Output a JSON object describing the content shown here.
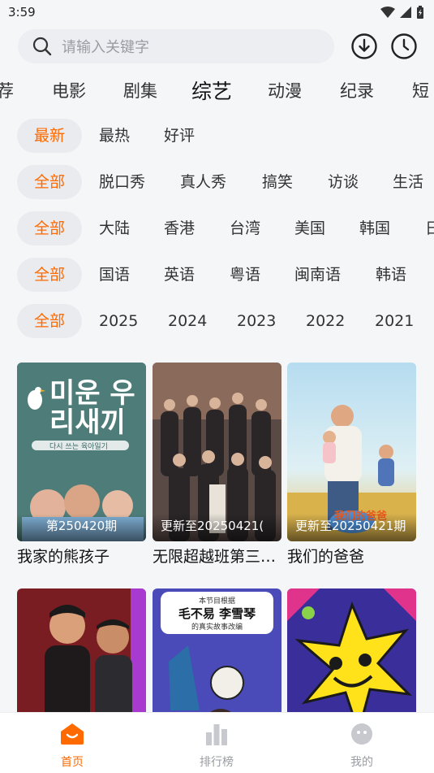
{
  "status_bar": {
    "time": "3:59"
  },
  "search": {
    "placeholder": "请输入关键字"
  },
  "category_tabs": [
    "荐",
    "电影",
    "剧集",
    "综艺",
    "动漫",
    "纪录",
    "短"
  ],
  "filters": {
    "sort": [
      "最新",
      "最热",
      "好评"
    ],
    "genre": [
      "全部",
      "脱口秀",
      "真人秀",
      "搞笑",
      "访谈",
      "生活"
    ],
    "region": [
      "全部",
      "大陆",
      "香港",
      "台湾",
      "美国",
      "韩国",
      "日"
    ],
    "language": [
      "全部",
      "国语",
      "英语",
      "粤语",
      "闽南语",
      "韩语"
    ],
    "year": [
      "全部",
      "2025",
      "2024",
      "2023",
      "2022",
      "2021"
    ]
  },
  "cards": [
    {
      "title": "我家的熊孩子",
      "badge": "第250420期",
      "poster_text": "미운 우리새끼",
      "poster_subtext": "다시 쓰는 육아일기"
    },
    {
      "title": "无限超越班第三…",
      "badge": "更新至20250421("
    },
    {
      "title": "我们的爸爸",
      "badge": "更新至20250421期",
      "poster_text": "我们的爸爸"
    },
    {
      "title": "",
      "badge": ""
    },
    {
      "title": "",
      "badge": "",
      "poster_text": "本节目根据",
      "poster_names": "毛不易  李雪琴",
      "poster_sub": "的真实故事改编"
    },
    {
      "title": "",
      "badge": ""
    }
  ],
  "bottom_nav": [
    {
      "label": "首页",
      "icon": "home-icon",
      "active": true
    },
    {
      "label": "排行榜",
      "icon": "ranking-icon",
      "active": false
    },
    {
      "label": "我的",
      "icon": "profile-icon",
      "active": false
    }
  ],
  "colors": {
    "accent": "#ff6a00",
    "chip_bg": "#eaebef",
    "background": "#f5f6f8"
  }
}
